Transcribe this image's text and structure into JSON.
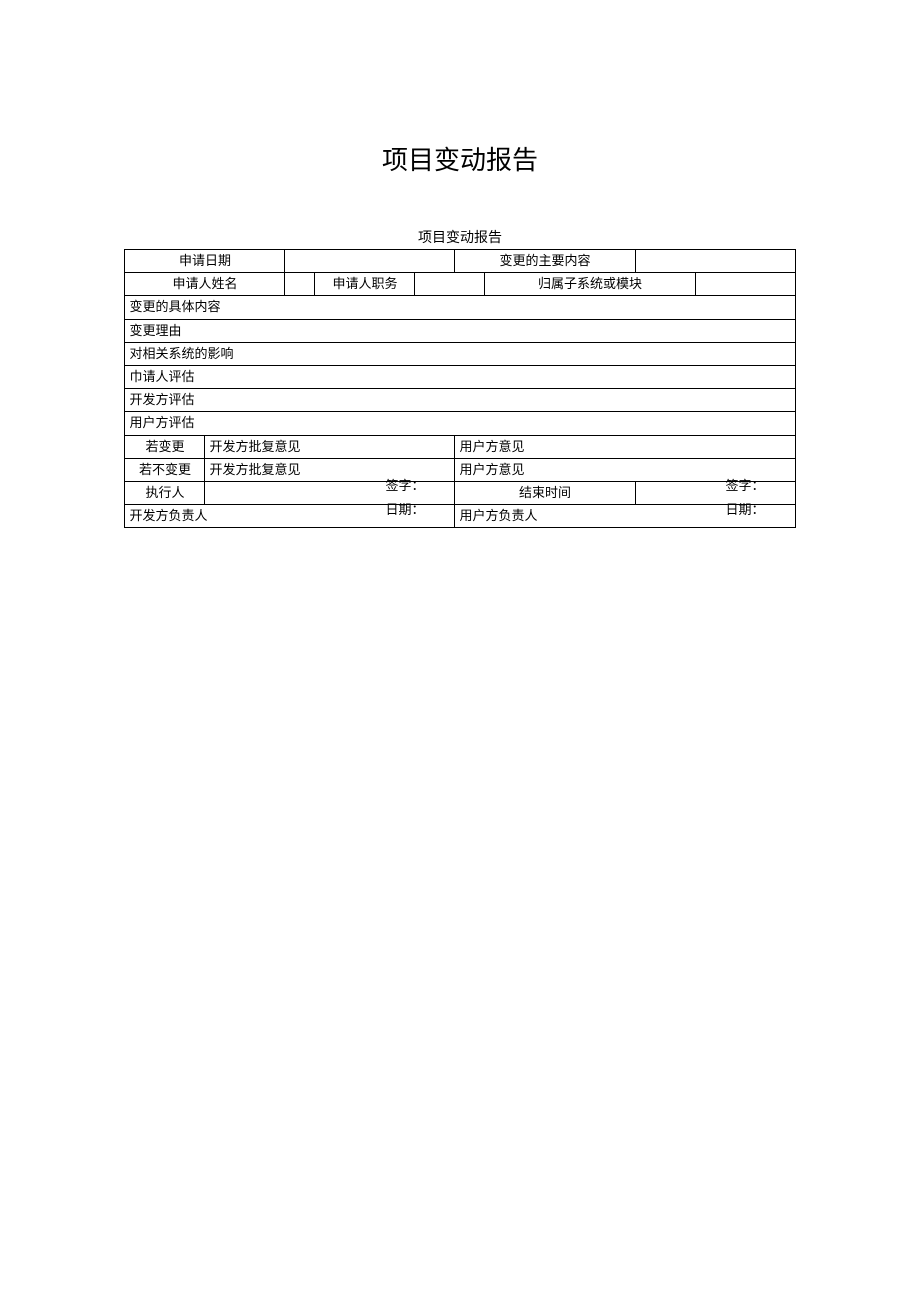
{
  "title": "项目变动报告",
  "caption": "项目变动报告",
  "labels": {
    "applyDate": "申请日期",
    "changeMainContent": "变更的主要内容",
    "applicantName": "申请人姓名",
    "applicantPost": "申请人职务",
    "subsystemModule": "归属子系统或模块",
    "changeDetail": "变更的具体内容",
    "changeReason": "变更理由",
    "impact": "对相关系统的影响",
    "applicantEval": "巾请人评估",
    "devEval": "开发方评估",
    "userEval": "用户方评估",
    "ifChange": "若变更",
    "ifNotChange": "若不变更",
    "devReply": "开发方批复意见",
    "userOpinion": "用户方意见",
    "executor": "执行人",
    "endTime": "结束时间",
    "devManager": "开发方负责人",
    "userManager": "用户方负责人",
    "signature": "签字：",
    "date": "日期："
  },
  "values": {
    "applyDate": "",
    "changeMainContent": "",
    "applicantName": "",
    "applicantPost": "",
    "subsystemModule": "",
    "changeDetail": "",
    "changeReason": "",
    "impact": "",
    "applicantEval": "",
    "devEval": "",
    "userEval": "",
    "ifChangeDevReply": "",
    "ifChangeUserOpinion": "",
    "ifNotChangeDevReply": "",
    "ifNotChangeUserOpinion": "",
    "executor": "",
    "endTime": "",
    "devManagerSig": "",
    "devManagerDate": "",
    "userManagerSig": "",
    "userManagerDate": ""
  }
}
